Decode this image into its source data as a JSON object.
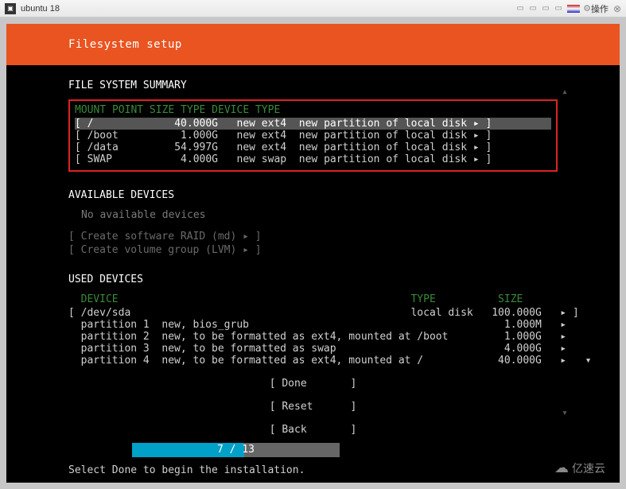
{
  "titlebar": {
    "vm_name": "ubuntu 18",
    "action_label": "操作"
  },
  "header": {
    "title": "Filesystem setup"
  },
  "fs_summary": {
    "title": "FILE SYSTEM SUMMARY",
    "columns": "  MOUNT POINT     SIZE     TYPE      DEVICE TYPE",
    "rows": [
      {
        "text": "[ /             40.000G   new ext4  new partition of local disk ▸ ]",
        "selected": true
      },
      {
        "text": "[ /boot          1.000G   new ext4  new partition of local disk ▸ ]",
        "selected": false
      },
      {
        "text": "[ /data         54.997G   new ext4  new partition of local disk ▸ ]",
        "selected": false
      },
      {
        "text": "[ SWAP           4.000G   new swap  new partition of local disk ▸ ]",
        "selected": false
      }
    ]
  },
  "available": {
    "title": "AVAILABLE DEVICES",
    "none": "No available devices",
    "raid": "[ Create software RAID (md) ▸ ]",
    "lvm": "[ Create volume group (LVM) ▸ ]"
  },
  "used": {
    "title": "USED DEVICES",
    "columns": "  DEVICE                                               TYPE          SIZE",
    "rows": [
      "[ /dev/sda                                             local disk   100.000G   ▸ ]",
      "  partition 1  new, bios_grub                                         1.000M   ▸",
      "  partition 2  new, to be formatted as ext4, mounted at /boot         1.000G   ▸",
      "  partition 3  new, to be formatted as swap                           4.000G   ▸",
      "  partition 4  new, to be formatted as ext4, mounted at /            40.000G   ▸   ▾"
    ]
  },
  "buttons": {
    "done": "[ Done       ]",
    "reset": "[ Reset      ]",
    "back": "[ Back       ]"
  },
  "progress": {
    "current": 7,
    "total": 13,
    "text": "7  /  13",
    "percent": 54
  },
  "hint": "Select Done to begin the installation.",
  "watermark": "亿速云"
}
